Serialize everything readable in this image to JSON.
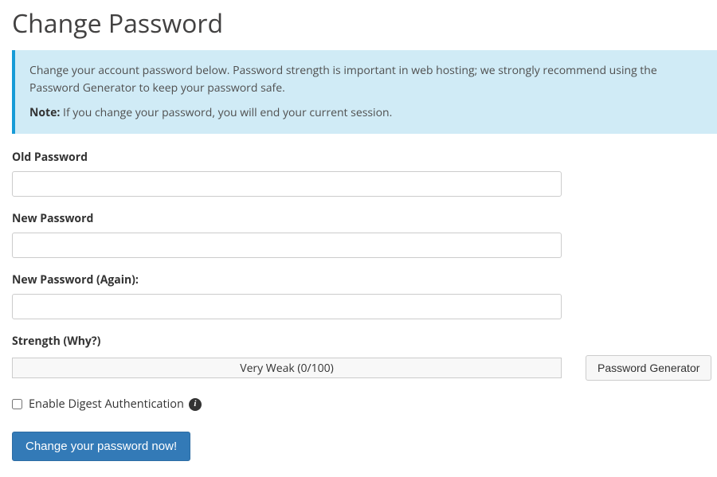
{
  "title": "Change Password",
  "alert": {
    "line1": "Change your account password below. Password strength is important in web hosting; we strongly recommend using the Password Generator to keep your password safe.",
    "note_label": "Note:",
    "note_text": " If you change your password, you will end your current session."
  },
  "form": {
    "old_password": {
      "label": "Old Password",
      "value": ""
    },
    "new_password": {
      "label": "New Password",
      "value": ""
    },
    "new_password_again": {
      "label": "New Password (Again):",
      "value": ""
    },
    "strength": {
      "label_prefix": "Strength (",
      "why_text": "Why?",
      "label_suffix": ")",
      "meter_text": "Very Weak (0/100)"
    },
    "generator_button": "Password Generator",
    "digest_checkbox": {
      "label": "Enable Digest Authentication",
      "checked": false
    },
    "submit_button": "Change your password now!"
  }
}
